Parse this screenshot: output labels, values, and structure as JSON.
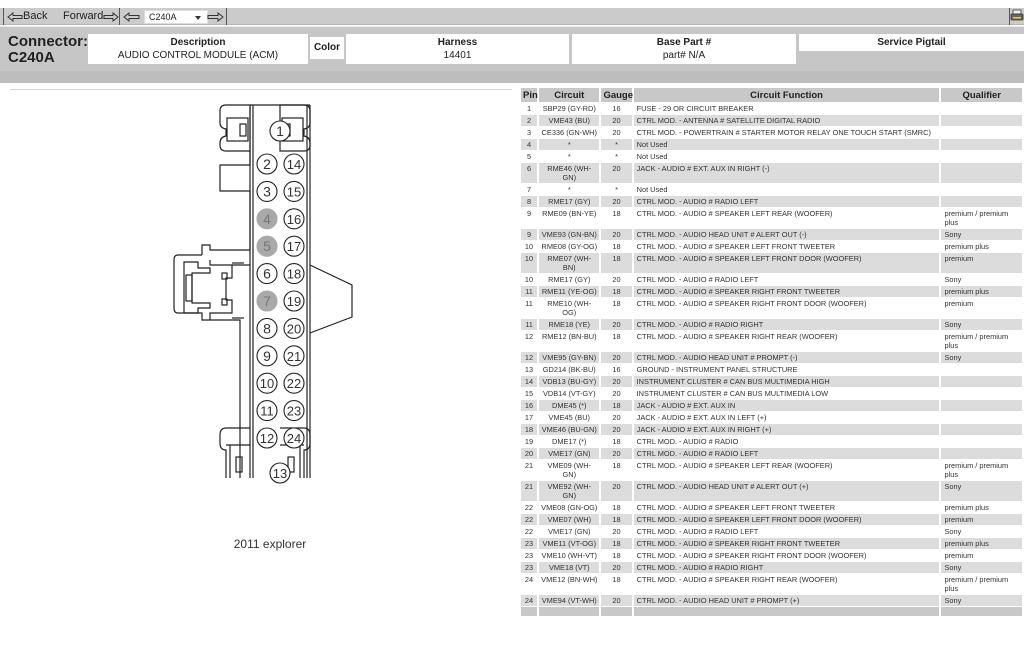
{
  "toolbar": {
    "back_label": "Back",
    "forward_label": "Forward",
    "connector_select_value": "C240A",
    "icons": {
      "back": "arrow-left-icon",
      "forward": "arrow-right-icon",
      "prev": "arrow-left-icon",
      "next": "arrow-right-icon",
      "print": "printer-icon"
    }
  },
  "connector": {
    "label": "Connector:",
    "id": "C240A",
    "description_label": "Description",
    "description_value": "AUDIO CONTROL MODULE (ACM)",
    "color_label": "Color",
    "harness_label": "Harness",
    "harness_value": "14401",
    "base_part_label": "Base Part #",
    "base_part_value": "part# N/A",
    "service_pigtail_label": "Service Pigtail"
  },
  "diagram": {
    "caption": "2011 explorer",
    "pins_left_column": [
      "2",
      "3",
      "4",
      "5",
      "6",
      "7",
      "8",
      "9",
      "10",
      "11",
      "12"
    ],
    "pins_right_column": [
      "14",
      "15",
      "16",
      "17",
      "18",
      "19",
      "20",
      "21",
      "22",
      "23",
      "24"
    ],
    "top_pin": "1",
    "bottom_pin": "13",
    "unused_pins": [
      "4",
      "5",
      "7"
    ]
  },
  "table": {
    "headers": [
      "Pin",
      "Circuit",
      "Gauge",
      "Circuit Function",
      "Qualifier"
    ],
    "rows": [
      {
        "pin": "1",
        "circuit": "SBP29 (GY-RD)",
        "gauge": "16",
        "function": "FUSE - 29 OR CIRCUIT BREAKER",
        "qualifier": ""
      },
      {
        "pin": "2",
        "circuit": "VME43 (BU)",
        "gauge": "20",
        "function": "CTRL MOD. - ANTENNA # SATELLITE DIGITAL RADIO",
        "qualifier": ""
      },
      {
        "pin": "3",
        "circuit": "CE336 (GN-WH)",
        "gauge": "20",
        "function": "CTRL MOD. - POWERTRAIN # STARTER MOTOR RELAY ONE TOUCH START (SMRC)",
        "qualifier": ""
      },
      {
        "pin": "4",
        "circuit": "*",
        "gauge": "*",
        "function": "Not Used",
        "qualifier": ""
      },
      {
        "pin": "5",
        "circuit": "*",
        "gauge": "*",
        "function": "Not Used",
        "qualifier": ""
      },
      {
        "pin": "6",
        "circuit": "RME46 (WH-GN)",
        "gauge": "20",
        "function": "JACK - AUDIO # EXT. AUX IN RIGHT (-)",
        "qualifier": ""
      },
      {
        "pin": "7",
        "circuit": "*",
        "gauge": "*",
        "function": "Not Used",
        "qualifier": ""
      },
      {
        "pin": "8",
        "circuit": "RME17 (GY)",
        "gauge": "20",
        "function": "CTRL MOD. - AUDIO # RADIO LEFT",
        "qualifier": ""
      },
      {
        "pin": "9",
        "circuit": "RME09 (BN-YE)",
        "gauge": "18",
        "function": "CTRL MOD. - AUDIO # SPEAKER LEFT REAR (WOOFER)",
        "qualifier": "premium / premium plus"
      },
      {
        "pin": "9",
        "circuit": "VME93 (GN-BN)",
        "gauge": "20",
        "function": "CTRL MOD. - AUDIO HEAD UNIT # ALERT OUT (-)",
        "qualifier": "Sony"
      },
      {
        "pin": "10",
        "circuit": "RME08 (GY-OG)",
        "gauge": "18",
        "function": "CTRL MOD. - AUDIO # SPEAKER LEFT FRONT TWEETER",
        "qualifier": "premium plus"
      },
      {
        "pin": "10",
        "circuit": "RME07 (WH-BN)",
        "gauge": "18",
        "function": "CTRL MOD. - AUDIO # SPEAKER LEFT FRONT DOOR (WOOFER)",
        "qualifier": "premium"
      },
      {
        "pin": "10",
        "circuit": "RME17 (GY)",
        "gauge": "20",
        "function": "CTRL MOD. - AUDIO # RADIO LEFT",
        "qualifier": "Sony"
      },
      {
        "pin": "11",
        "circuit": "RME11 (YE-OG)",
        "gauge": "18",
        "function": "CTRL MOD. - AUDIO # SPEAKER RIGHT FRONT TWEETER",
        "qualifier": "premium plus"
      },
      {
        "pin": "11",
        "circuit": "RME10 (WH-OG)",
        "gauge": "18",
        "function": "CTRL MOD. - AUDIO # SPEAKER RIGHT FRONT DOOR (WOOFER)",
        "qualifier": "premium"
      },
      {
        "pin": "11",
        "circuit": "RME18 (YE)",
        "gauge": "20",
        "function": "CTRL MOD. - AUDIO # RADIO RIGHT",
        "qualifier": "Sony"
      },
      {
        "pin": "12",
        "circuit": "RME12 (BN-BU)",
        "gauge": "18",
        "function": "CTRL MOD. - AUDIO # SPEAKER RIGHT REAR (WOOFER)",
        "qualifier": "premium / premium plus"
      },
      {
        "pin": "12",
        "circuit": "VME95 (GY-BN)",
        "gauge": "20",
        "function": "CTRL MOD. - AUDIO HEAD UNIT # PROMPT (-)",
        "qualifier": "Sony"
      },
      {
        "pin": "13",
        "circuit": "GD214 (BK-BU)",
        "gauge": "16",
        "function": "GROUND - INSTRUMENT PANEL STRUCTURE",
        "qualifier": ""
      },
      {
        "pin": "14",
        "circuit": "VDB13 (BU-GY)",
        "gauge": "20",
        "function": "INSTRUMENT CLUSTER # CAN BUS MULTIMEDIA HIGH",
        "qualifier": ""
      },
      {
        "pin": "15",
        "circuit": "VDB14 (VT-GY)",
        "gauge": "20",
        "function": "INSTRUMENT CLUSTER # CAN BUS MULTIMEDIA LOW",
        "qualifier": ""
      },
      {
        "pin": "16",
        "circuit": "DME45 (*)",
        "gauge": "18",
        "function": "JACK - AUDIO # EXT. AUX IN",
        "qualifier": ""
      },
      {
        "pin": "17",
        "circuit": "VME45 (BU)",
        "gauge": "20",
        "function": "JACK - AUDIO # EXT. AUX IN LEFT (+)",
        "qualifier": ""
      },
      {
        "pin": "18",
        "circuit": "VME46 (BU-GN)",
        "gauge": "20",
        "function": "JACK - AUDIO # EXT. AUX IN RIGHT (+)",
        "qualifier": ""
      },
      {
        "pin": "19",
        "circuit": "DME17 (*)",
        "gauge": "18",
        "function": "CTRL MOD. - AUDIO # RADIO",
        "qualifier": ""
      },
      {
        "pin": "20",
        "circuit": "VME17 (GN)",
        "gauge": "20",
        "function": "CTRL MOD. - AUDIO # RADIO LEFT",
        "qualifier": ""
      },
      {
        "pin": "21",
        "circuit": "VME09 (WH-GN)",
        "gauge": "18",
        "function": "CTRL MOD. - AUDIO # SPEAKER LEFT REAR (WOOFER)",
        "qualifier": "premium / premium plus"
      },
      {
        "pin": "21",
        "circuit": "VME92 (WH-GN)",
        "gauge": "20",
        "function": "CTRL MOD. - AUDIO HEAD UNIT # ALERT OUT (+)",
        "qualifier": "Sony"
      },
      {
        "pin": "22",
        "circuit": "VME08 (GN-OG)",
        "gauge": "18",
        "function": "CTRL MOD. - AUDIO # SPEAKER LEFT FRONT TWEETER",
        "qualifier": "premium plus"
      },
      {
        "pin": "22",
        "circuit": "VME07 (WH)",
        "gauge": "18",
        "function": "CTRL MOD. - AUDIO # SPEAKER LEFT FRONT DOOR (WOOFER)",
        "qualifier": "premium"
      },
      {
        "pin": "22",
        "circuit": "VME17 (GN)",
        "gauge": "20",
        "function": "CTRL MOD. - AUDIO # RADIO LEFT",
        "qualifier": "Sony"
      },
      {
        "pin": "23",
        "circuit": "VME11 (VT-OG)",
        "gauge": "18",
        "function": "CTRL MOD. - AUDIO # SPEAKER RIGHT FRONT TWEETER",
        "qualifier": "premium plus"
      },
      {
        "pin": "23",
        "circuit": "VME10 (WH-VT)",
        "gauge": "18",
        "function": "CTRL MOD. - AUDIO # SPEAKER RIGHT FRONT DOOR (WOOFER)",
        "qualifier": "premium"
      },
      {
        "pin": "23",
        "circuit": "VME18 (VT)",
        "gauge": "20",
        "function": "CTRL MOD. - AUDIO # RADIO RIGHT",
        "qualifier": "Sony"
      },
      {
        "pin": "24",
        "circuit": "VME12 (BN-WH)",
        "gauge": "18",
        "function": "CTRL MOD. - AUDIO # SPEAKER RIGHT REAR (WOOFER)",
        "qualifier": "premium / premium plus"
      },
      {
        "pin": "24",
        "circuit": "VME94 (VT-WH)",
        "gauge": "20",
        "function": "CTRL MOD. - AUDIO HEAD UNIT # PROMPT (+)",
        "qualifier": "Sony"
      }
    ]
  }
}
